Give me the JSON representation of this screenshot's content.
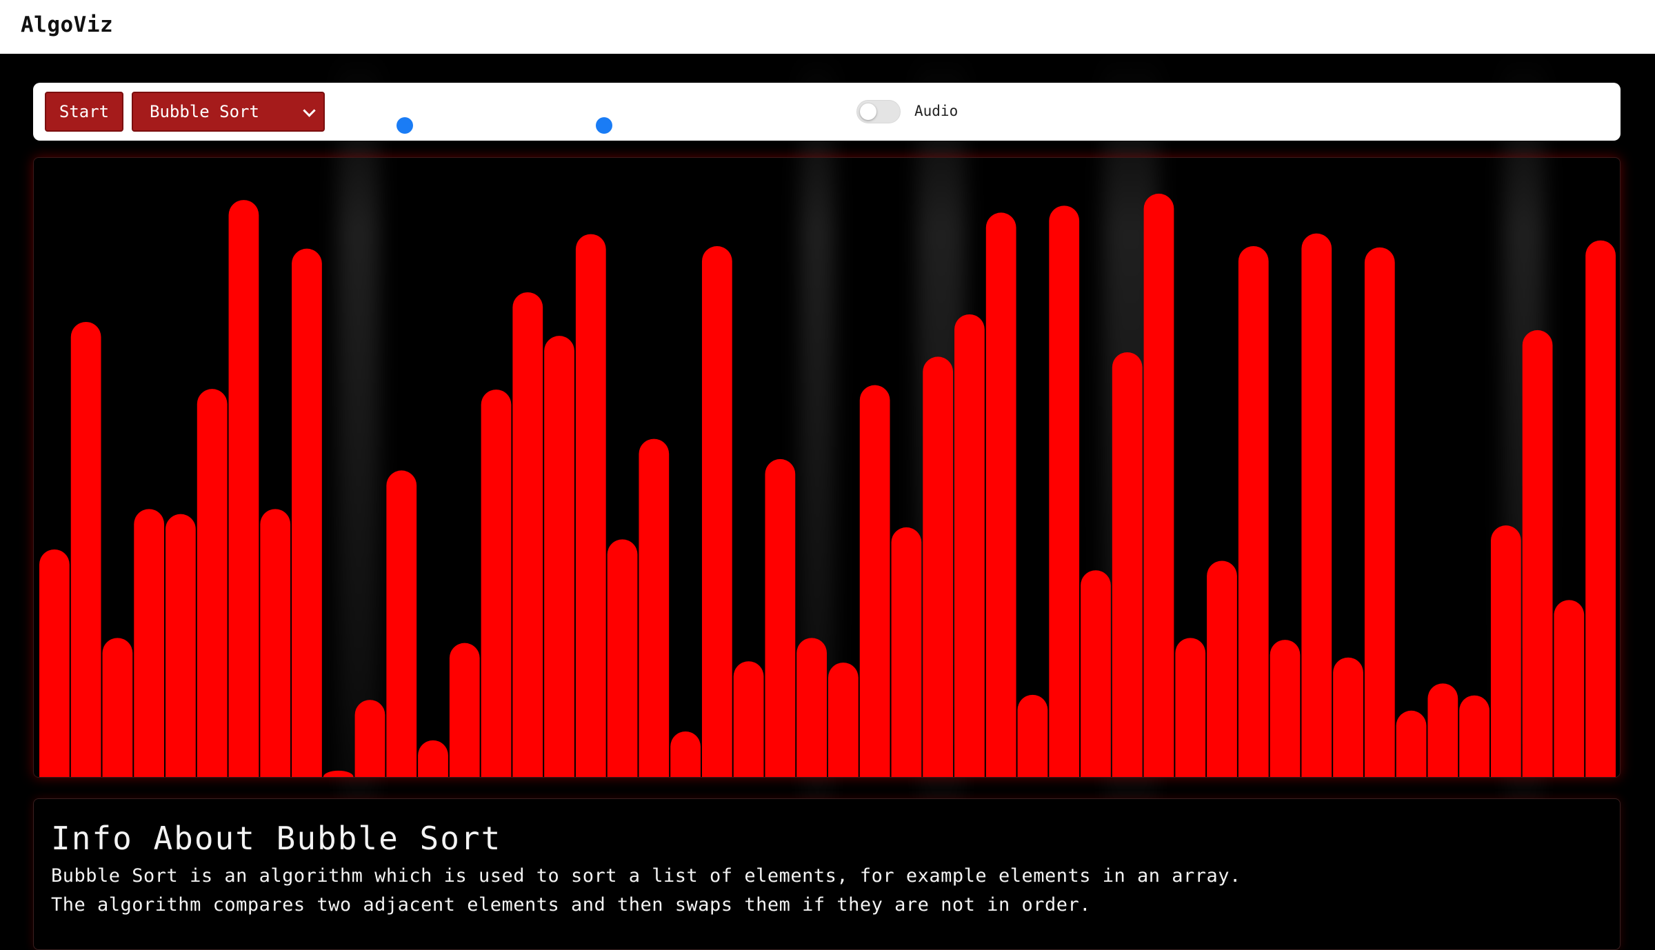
{
  "navbar": {
    "brand": "AlgoViz"
  },
  "controls": {
    "start_label": "Start",
    "algorithm_selected": "Bubble Sort",
    "speed_slider_value": 0.3,
    "size_slider_value": 0.6,
    "audio_label": "Audio",
    "audio_on": false
  },
  "colors": {
    "bar": "#ff0000",
    "button": "#a51b1b",
    "slider": "#1a7cf5"
  },
  "chart_data": {
    "type": "bar",
    "values": [
      360,
      720,
      220,
      424,
      416,
      614,
      913,
      424,
      836,
      10,
      122,
      485,
      58,
      212,
      613,
      767,
      698,
      859,
      376,
      535,
      72,
      840,
      183,
      503,
      220,
      181,
      620,
      395,
      665,
      732,
      893,
      130,
      904,
      327,
      672,
      923,
      220,
      342,
      840,
      217,
      860,
      189,
      838,
      105,
      148,
      129,
      398,
      707,
      280,
      849
    ],
    "ylim": [
      0,
      960
    ]
  },
  "info": {
    "title": "Info About Bubble Sort",
    "lines": [
      "Bubble Sort is an algorithm which is used to sort a list of elements, for example elements in an array.",
      "The algorithm compares two adjacent elements and then swaps them if they are not in order."
    ]
  }
}
